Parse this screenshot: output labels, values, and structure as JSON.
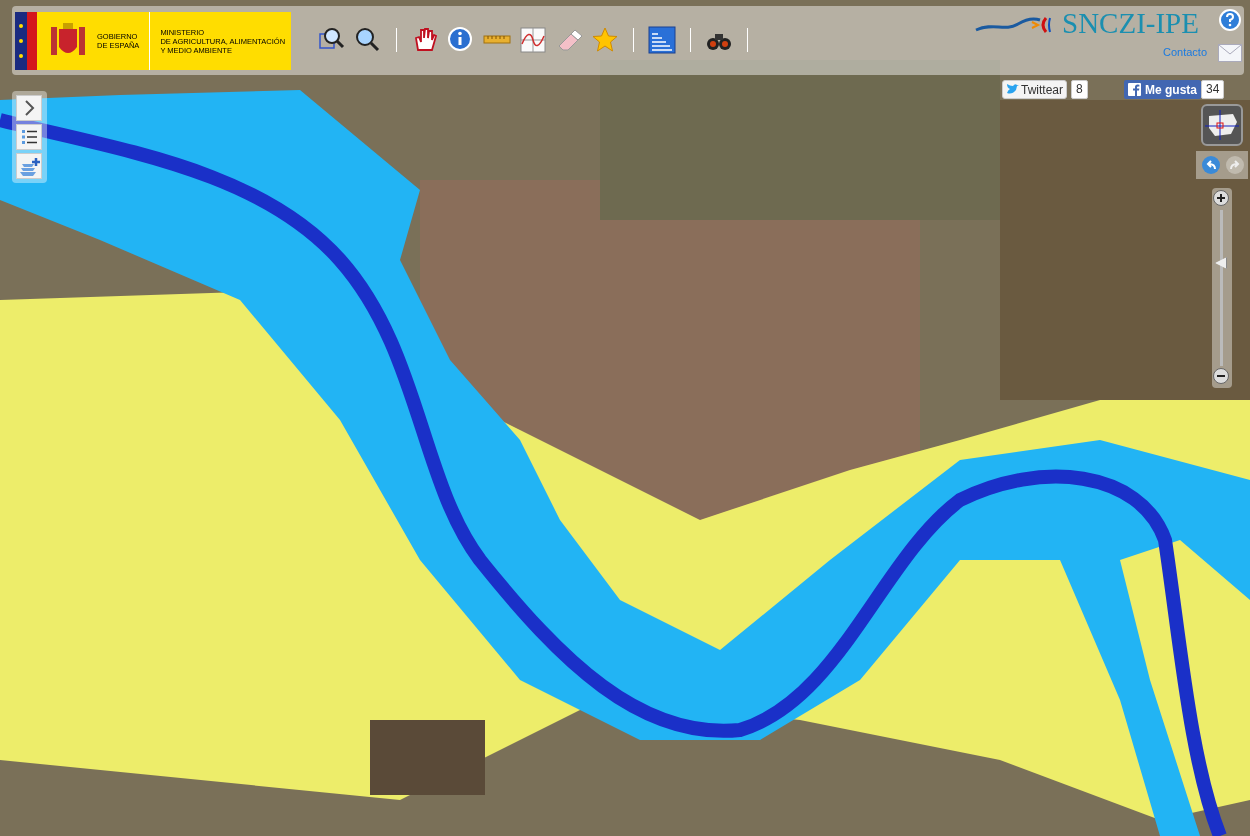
{
  "logo": {
    "government": [
      "GOBIERNO",
      "DE ESPAÑA"
    ],
    "ministry": [
      "MINISTERIO",
      "DE AGRICULTURA, ALIMENTACIÓN",
      "Y MEDIO AMBIENTE"
    ]
  },
  "toolbar": [
    {
      "kind": "zoom-box"
    },
    {
      "kind": "zoom-out"
    },
    {
      "kind": "separator"
    },
    {
      "kind": "pan"
    },
    {
      "kind": "info"
    },
    {
      "kind": "ruler"
    },
    {
      "kind": "profile"
    },
    {
      "kind": "eraser"
    },
    {
      "kind": "star"
    },
    {
      "kind": "separator"
    },
    {
      "kind": "flood"
    },
    {
      "kind": "separator"
    },
    {
      "kind": "binoculars"
    },
    {
      "kind": "separator"
    }
  ],
  "app_title": "SNCZI-IPE",
  "contact": "Contacto",
  "social": [
    {
      "kind": "twitter",
      "label": "Twittear",
      "count": "8"
    },
    {
      "kind": "facebook",
      "label": "Me gusta",
      "count": "34"
    }
  ],
  "side_buttons": [
    {
      "kind": "expand"
    },
    {
      "kind": "legend"
    },
    {
      "kind": "add-layer"
    }
  ],
  "zoom": {
    "level": 0.66
  }
}
